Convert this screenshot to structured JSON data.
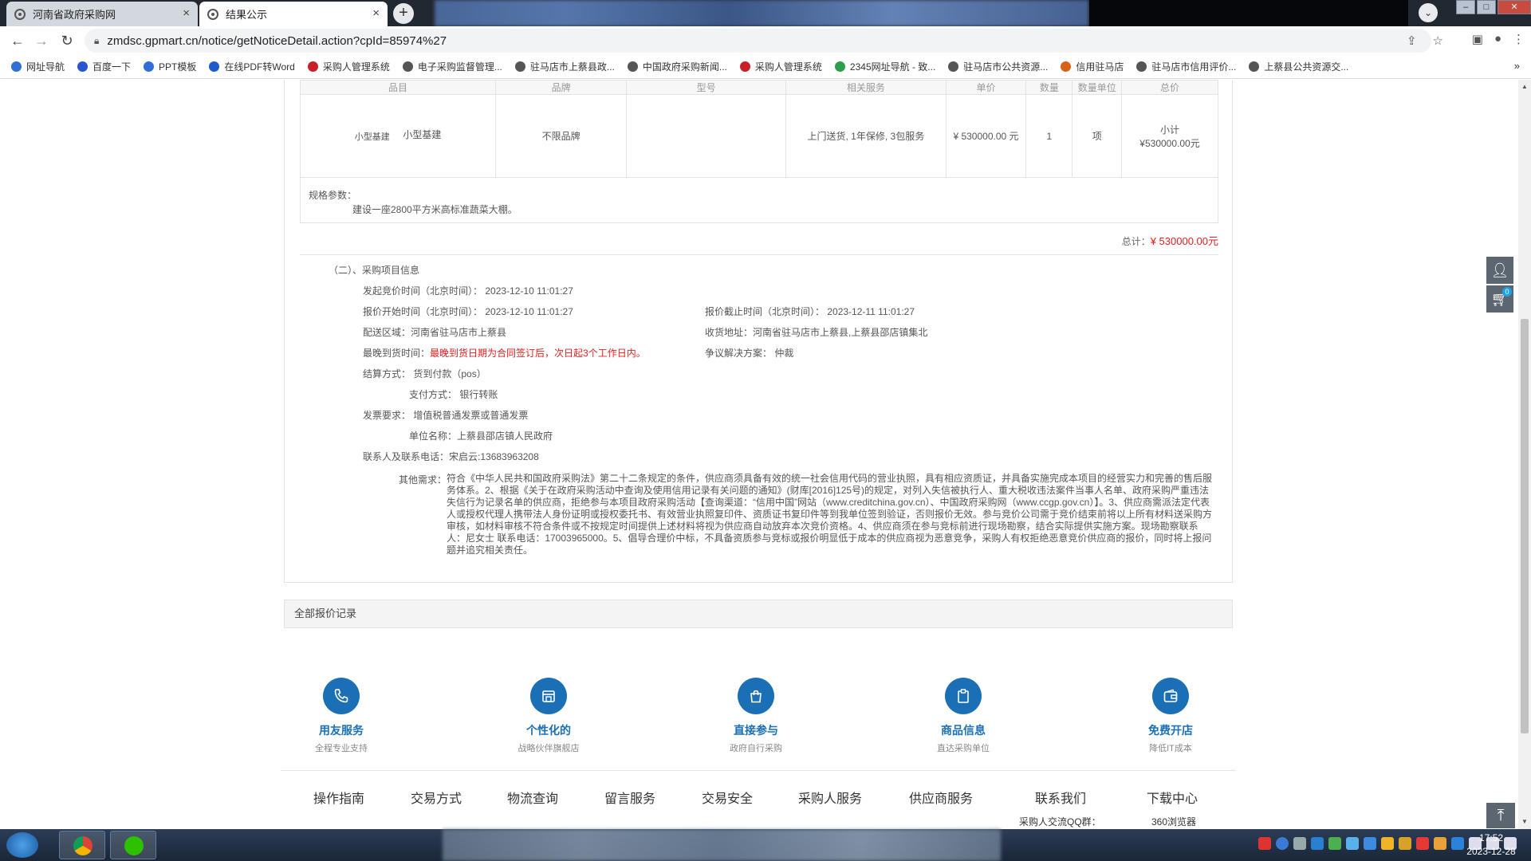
{
  "browser": {
    "tabs": [
      {
        "title": "河南省政府采购网",
        "close": "×"
      },
      {
        "title": "结果公示",
        "close": "×"
      }
    ],
    "new_tab": "+",
    "url": "zmdsc.gpmart.cn/notice/getNoticeDetail.action?cpId=85974%27",
    "bookmarks": [
      {
        "label": "网址导航",
        "color": "#2f6fd6"
      },
      {
        "label": "百度一下",
        "color": "#2a55d0"
      },
      {
        "label": "PPT模板",
        "color": "#2f6fd6"
      },
      {
        "label": "在线PDF转Word",
        "color": "#1f5ac8"
      },
      {
        "label": "采购人管理系统",
        "color": "#c8202a"
      },
      {
        "label": "电子采购监督管理...",
        "color": "#555555"
      },
      {
        "label": "驻马店市上蔡县政...",
        "color": "#555555"
      },
      {
        "label": "中国政府采购新闻...",
        "color": "#555555"
      },
      {
        "label": "采购人管理系统",
        "color": "#c8202a"
      },
      {
        "label": "2345网址导航 - 致...",
        "color": "#2aa04a"
      },
      {
        "label": "驻马店市公共资源...",
        "color": "#555555"
      },
      {
        "label": "信用驻马店",
        "color": "#d8621a"
      },
      {
        "label": "驻马店市信用评价...",
        "color": "#555555"
      },
      {
        "label": "上蔡县公共资源交...",
        "color": "#555555"
      }
    ],
    "bookmarks_more": "»"
  },
  "items_table": {
    "headers": [
      "品目",
      "品牌",
      "型号",
      "相关服务",
      "单价",
      "数量",
      "数量单位",
      "总价"
    ],
    "row": {
      "category_a": "小型基建",
      "category_b": "小型基建",
      "brand": "不限品牌",
      "model": "",
      "service": "上门送货, 1年保修, 3包服务",
      "unit_price": "¥ 530000.00 元",
      "qty": "1",
      "unit": "项",
      "subtotal_label": "小计",
      "subtotal": "¥530000.00元"
    },
    "spec_label": "规格参数：",
    "spec_value": "建设一座2800平方米高标准蔬菜大棚。",
    "total_label": "总计：",
    "total_amount": "¥ 530000.00元"
  },
  "project_info": {
    "section_title": "（二）、采购项目信息",
    "start_time_label": "发起竞价时间（北京时间）：",
    "start_time": "2023-12-10 11:01:27",
    "quote_start_label": "报价开始时间（北京时间）：",
    "quote_start": "2023-12-10 11:01:27",
    "quote_end_label": "报价截止时间（北京时间）：",
    "quote_end": "2023-12-11 11:01:27",
    "region_label": "配送区域：",
    "region": "河南省驻马店市上蔡县",
    "address_label": "收货地址：",
    "address": "河南省驻马店市上蔡县,上蔡县邵店镇集北",
    "delivery_label": "最晚到货时间：",
    "delivery": "最晚到货日期为合同签订后，次日起3个工作日内。",
    "dispute_label": "争议解决方案：",
    "dispute": "仲裁",
    "settle_label": "结算方式：",
    "settle": "货到付款（pos）",
    "pay_label": "支付方式：",
    "pay": "银行转账",
    "invoice_label": "发票要求：",
    "invoice": "增值税普通发票或普通发票",
    "unit_label": "单位名称：",
    "unit_name": "上蔡县邵店镇人民政府",
    "contact_label": "联系人及联系电话：",
    "contact": "宋启云:13683963208",
    "other_label": "其他需求：",
    "other_text": "符合《中华人民共和国政府采购法》第二十二条规定的条件，供应商须具备有效的统一社会信用代码的营业执照，具有相应资质证，并具备实施完成本项目的经营实力和完善的售后服务体系。2、根据《关于在政府采购活动中查询及使用信用记录有关问题的通知》(财库[2016]125号)的规定，对列入失信被执行人、重大税收违法案件当事人名单、政府采购严重违法失信行为记录名单的供应商，拒绝参与本项目政府采购活动【查询渠道：“信用中国”网站（www.creditchina.gov.cn）、中国政府采购网（www.ccgp.gov.cn）】。3、供应商需派法定代表人或授权代理人携带法人身份证明或授权委托书、有效营业执照复印件、资质证书复印件等到我单位签到验证，否则报价无效。参与竞价公司需于竞价结束前将以上所有材料送采购方审核，如材料审核不符合条件或不按规定时间提供上述材料将视为供应商自动放弃本次竞价资格。4、供应商须在参与竞标前进行现场勘察，结合实际提供实施方案。现场勘察联系人：尼女士 联系电话：17003965000。5、倡导合理价中标，不具备资质参与竞标或报价明显低于成本的供应商视为恶意竞争，采购人有权拒绝恶意竞价供应商的报价，同时将上报问题并追究相关责任。"
  },
  "records_title": "全部报价记录",
  "services": [
    {
      "title": "用友服务",
      "sub": "全程专业支持",
      "icon": "phone-icon"
    },
    {
      "title": "个性化的",
      "sub": "战略伙伴旗舰店",
      "icon": "store-icon"
    },
    {
      "title": "直接参与",
      "sub": "政府自行采购",
      "icon": "bag-icon"
    },
    {
      "title": "商品信息",
      "sub": "直达采购单位",
      "icon": "clipboard-icon"
    },
    {
      "title": "免费开店",
      "sub": "降低IT成本",
      "icon": "wallet-icon"
    }
  ],
  "footer_nav": [
    "操作指南",
    "交易方式",
    "物流查询",
    "留言服务",
    "交易安全",
    "采购人服务",
    "供应商服务",
    "联系我们",
    "下载中心"
  ],
  "footer_small": [
    "采购人交流QQ群：",
    "360浏览器"
  ],
  "side_cart_count": "0",
  "taskbar": {
    "time": "17:52",
    "date": "2023-12-28"
  }
}
